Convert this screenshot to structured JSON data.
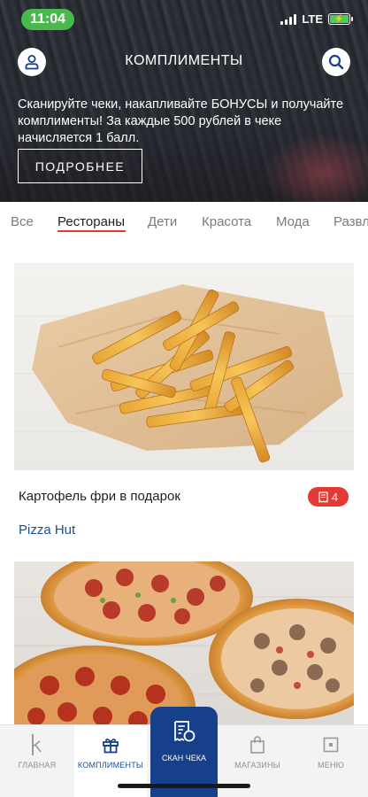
{
  "status_bar": {
    "time": "11:04",
    "network": "LTE"
  },
  "header": {
    "title": "КОМПЛИМЕНТЫ",
    "promo_text": "Сканируйте чеки, накапливайте БОНУСЫ и получайте комплименты! За каждые 500 рублей в чеке начисляется 1 балл.",
    "more_button": "ПОДРОБНЕЕ"
  },
  "tabs": [
    {
      "label": "Все"
    },
    {
      "label": "Рестораны",
      "active": true
    },
    {
      "label": "Дети"
    },
    {
      "label": "Красота"
    },
    {
      "label": "Мода"
    },
    {
      "label": "Развлечения"
    }
  ],
  "offers": [
    {
      "title": "Картофель фри в подарок",
      "points": "4",
      "brand": "Pizza Hut",
      "image": "french-fries"
    },
    {
      "image": "pizzas"
    }
  ],
  "bottom_nav": {
    "home": "ГЛАВНАЯ",
    "compliments": "КОМПЛИМЕНТЫ",
    "scan": "СКАН ЧЕКА",
    "stores": "МАГАЗИНЫ",
    "menu": "МЕНЮ"
  },
  "colors": {
    "accent_red": "#e53935",
    "brand_blue": "#16408a",
    "link_blue": "#1d4f8f",
    "status_green": "#49b84d"
  }
}
